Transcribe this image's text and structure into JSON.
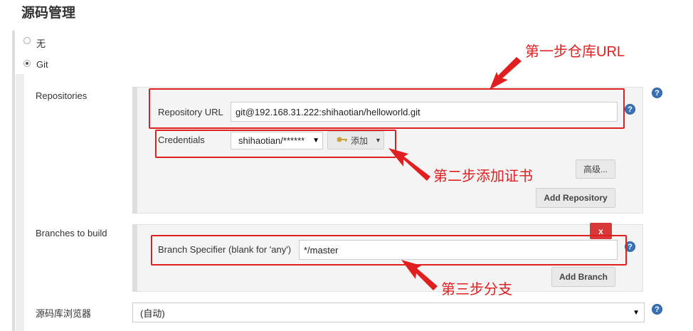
{
  "section_title": "源码管理",
  "scm_options": [
    {
      "label": "无",
      "selected": false
    },
    {
      "label": "Git",
      "selected": true
    }
  ],
  "repositories": {
    "label": "Repositories",
    "url_label": "Repository URL",
    "url_value": "git@192.168.31.222:shihaotian/helloworld.git",
    "credentials_label": "Credentials",
    "credentials_value": "shihaotian/******",
    "add_label": "添加",
    "advanced_label": "高级...",
    "add_repository_label": "Add Repository"
  },
  "branches": {
    "label": "Branches to build",
    "specifier_label": "Branch Specifier (blank for 'any')",
    "specifier_value": "*/master",
    "delete_label": "x",
    "add_branch_label": "Add Branch"
  },
  "browser": {
    "label": "源码库浏览器",
    "value": "(自动)"
  },
  "annotations": {
    "step1": "第一步仓库URL",
    "step2": "第二步添加证书",
    "step3": "第三步分支"
  },
  "help_glyph": "?",
  "colors": {
    "annotation": "#e02020",
    "help_icon": "#3a73b5",
    "delete_button": "#d9383a"
  }
}
